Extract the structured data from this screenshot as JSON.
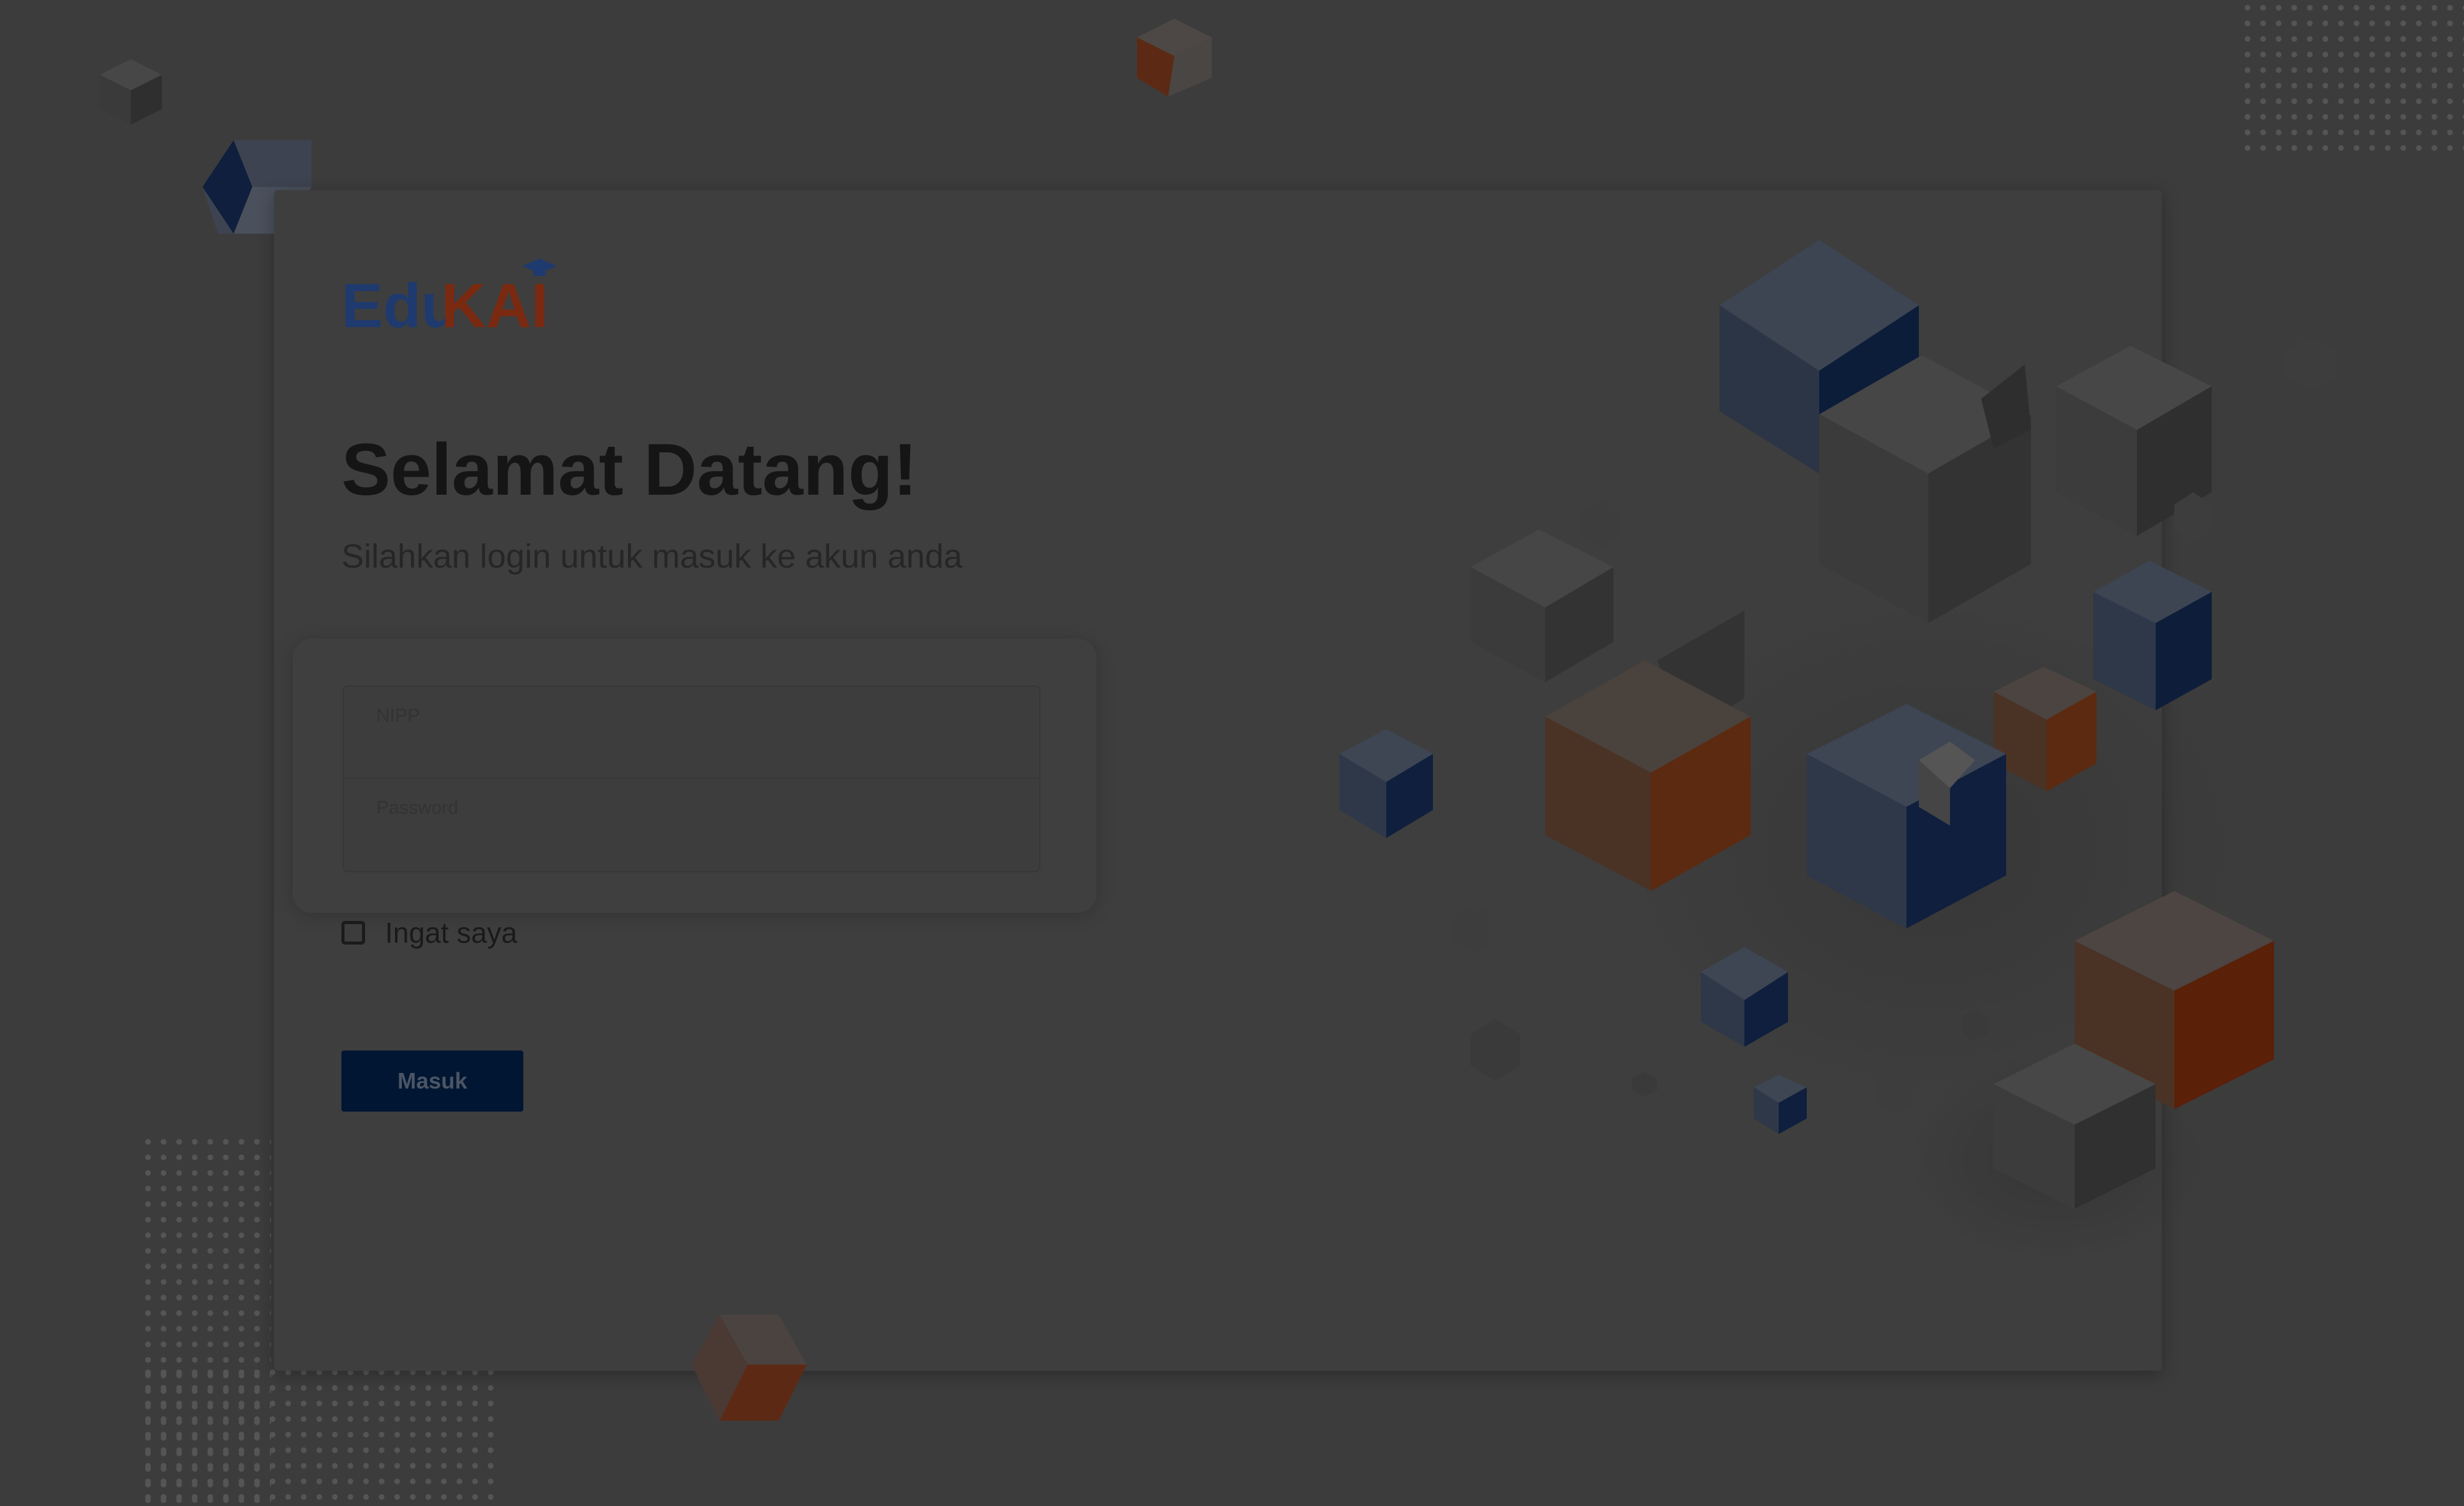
{
  "brand": {
    "name_part1": "Edu",
    "name_part2": "KAI",
    "color_part1": "#1f3a6e",
    "color_part2": "#7a2a10"
  },
  "header": {
    "title": "Selamat Datang!",
    "subtitle": "Silahkan login untuk masuk ke akun anda"
  },
  "form": {
    "nipp_label": "NIPP",
    "nipp_value": "",
    "password_label": "Password",
    "password_value": "",
    "remember_label": "Ingat saya",
    "remember_checked": false,
    "submit_label": "Masuk"
  },
  "colors": {
    "overlay": "#3c3c3c",
    "accent_navy": "#001632",
    "accent_orange": "#7a3310",
    "accent_blue": "#2d3e55"
  }
}
